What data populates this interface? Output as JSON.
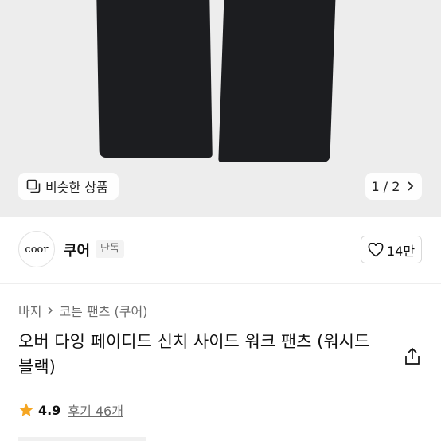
{
  "gallery": {
    "similar_label": "비슷한 상품",
    "page_indicator": "1 / 2"
  },
  "brand": {
    "logo_text": "coor",
    "name": "쿠어",
    "badge": "단독",
    "likes": "14만"
  },
  "breadcrumb": {
    "items": [
      "바지",
      "코튼 팬츠 (쿠어)"
    ]
  },
  "product": {
    "title": "오버 다잉 페이디드 신치 사이드 워크 팬츠 (워시드블랙)"
  },
  "rating": {
    "score": "4.9",
    "reviews": "후기 46개",
    "star_color": "#f5a623"
  }
}
